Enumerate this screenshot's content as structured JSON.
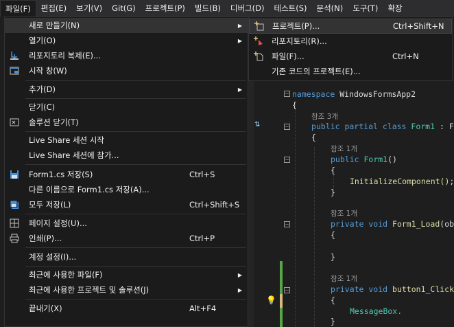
{
  "menubar": {
    "items": [
      "파일(F)",
      "편집(E)",
      "보기(V)",
      "Git(G)",
      "프로젝트(P)",
      "빌드(B)",
      "디버그(D)",
      "테스트(S)",
      "분석(N)",
      "도구(T)",
      "확장"
    ]
  },
  "file_menu": {
    "new": "새로 만들기(N)",
    "open": "열기(O)",
    "clone": "리포지토리 복제(E)...",
    "start_window": "시작 창(W)",
    "add": "추가(D)",
    "close": "닫기(C)",
    "close_solution": "솔루션 닫기(T)",
    "liveshare_start": "Live Share 세션 시작",
    "liveshare_join": "Live Share 세션에 참가...",
    "save": "Form1.cs 저장(S)",
    "save_sc": "Ctrl+S",
    "save_as": "다른 이름으로 Form1.cs 저장(A)...",
    "save_all": "모두 저장(L)",
    "save_all_sc": "Ctrl+Shift+S",
    "page_setup": "페이지 설정(U)...",
    "print": "인쇄(P)...",
    "print_sc": "Ctrl+P",
    "account": "계정 설정(I)...",
    "recent_files": "최근에 사용한 파일(F)",
    "recent_projects": "최근에 사용한 프로젝트 및 솔루션(J)",
    "exit": "끝내기(X)",
    "exit_sc": "Alt+F4"
  },
  "new_submenu": {
    "project": "프로젝트(P)...",
    "project_sc": "Ctrl+Shift+N",
    "repository": "리포지토리(R)...",
    "file": "파일(F)...",
    "file_sc": "Ctrl+N",
    "from_code": "기존 코드의 프로젝트(E)..."
  },
  "code": {
    "namespace_kw": "namespace",
    "namespace_name": " WindowsFormsApp2",
    "open_brace": "{",
    "close_brace": "}",
    "ref3": "참조 3개",
    "ref1": "참조 1개",
    "class_mod": "public partial class",
    "class_name": " Form1",
    "class_tail": " : F",
    "ctor_mod": "public",
    "ctor_name": " Form1",
    "ctor_tail": "()",
    "init_call": "InitializeComponent();",
    "load_mod": "private void",
    "load_name": " Form1_Load",
    "load_tail": "(ob",
    "click_mod": "private void",
    "click_name": " button1_Click",
    "msgbox": "MessageBox."
  }
}
